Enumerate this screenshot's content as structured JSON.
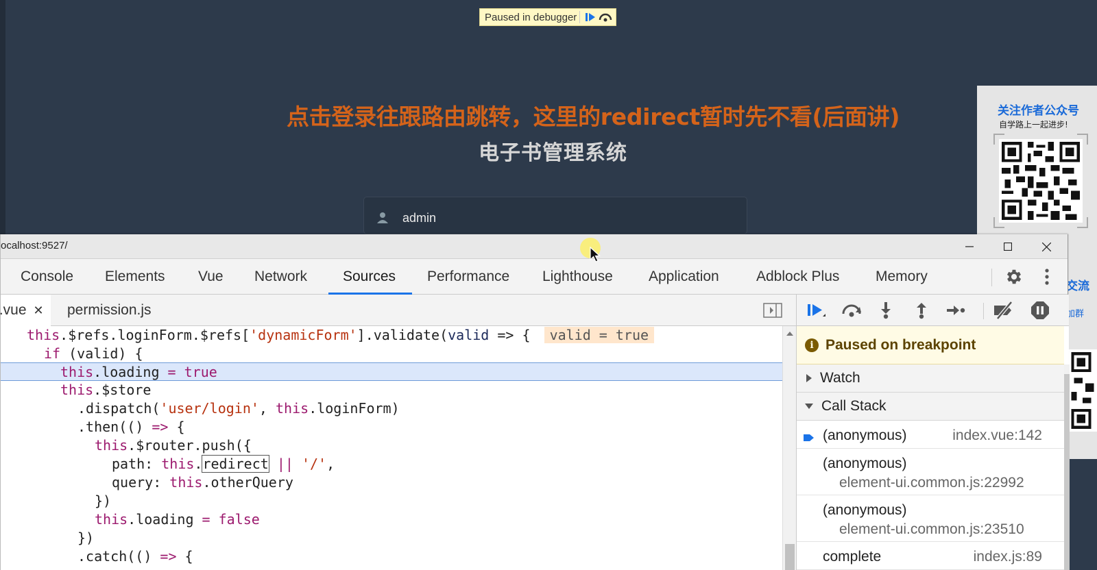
{
  "page": {
    "debugger_badge": "Paused in debugger",
    "annotation": "点击登录往跟路由跳转，这里的redirect暂时先不看(后面讲)",
    "login_title": "电子书管理系统",
    "username_value": "admin"
  },
  "ad": {
    "title": "关注作者公众号",
    "subtitle": "自学路上一起进步!",
    "side_text_1": "交流",
    "side_text_2": "加群"
  },
  "devtools": {
    "url": "ocalhost:9527/",
    "tabs": [
      "Console",
      "Elements",
      "Vue",
      "Network",
      "Sources",
      "Performance",
      "Lighthouse",
      "Application",
      "Adblock Plus",
      "Memory"
    ],
    "active_tab": "Sources",
    "file_tabs": {
      "active": "t.vue",
      "other": "permission.js",
      "close_glyph": "✕"
    },
    "code": {
      "l1_a": "this",
      "l1_b": ".$refs.loginForm.$refs[",
      "l1_str": "'dynamicForm'",
      "l1_c": "].validate(",
      "l1_param": "valid",
      "l1_d": " => {",
      "l1_inline": "valid = true",
      "l2_a": "if",
      "l2_b": " (valid) {",
      "l3_kw": "this",
      "l3_b": ".loading ",
      "l3_op": "=",
      "l3_val": " true",
      "l4_kw": "this",
      "l4_b": ".$store",
      "l5_a": ".dispatch(",
      "l5_str": "'user/login'",
      "l5_b": ", ",
      "l5_kw": "this",
      "l5_c": ".loginForm)",
      "l6_a": ".then(() ",
      "l6_op": "=>",
      "l6_b": " {",
      "l7_kw": "this",
      "l7_b": ".$router.push({",
      "l8_a": "path: ",
      "l8_kw": "this",
      "l8_dot": ".",
      "l8_boxed": "redirect",
      "l8_op": " || ",
      "l8_str": "'/'",
      "l8_c": ",",
      "l9_a": "query: ",
      "l9_kw": "this",
      "l9_b": ".otherQuery",
      "l10": "})",
      "l11_kw": "this",
      "l11_b": ".loading ",
      "l11_op": "=",
      "l11_val": " false",
      "l12": "})",
      "l13_a": ".catch(() ",
      "l13_op": "=>",
      "l13_b": " {"
    },
    "sidebar": {
      "paused_text": "Paused on breakpoint",
      "info_glyph": "i",
      "watch_label": "Watch",
      "callstack_label": "Call Stack",
      "frames": [
        {
          "fn": "(anonymous)",
          "loc": "index.vue:142"
        },
        {
          "fn": "(anonymous)",
          "loc": "element-ui.common.js:22992"
        },
        {
          "fn": "(anonymous)",
          "loc": "element-ui.common.js:23510"
        },
        {
          "fn": "complete",
          "loc": "index.js:89"
        }
      ]
    }
  },
  "colors": {
    "accent": "#1a73e8",
    "annotation": "#d4631a",
    "keyword": "#9c1a6e",
    "string": "#b7320f"
  }
}
